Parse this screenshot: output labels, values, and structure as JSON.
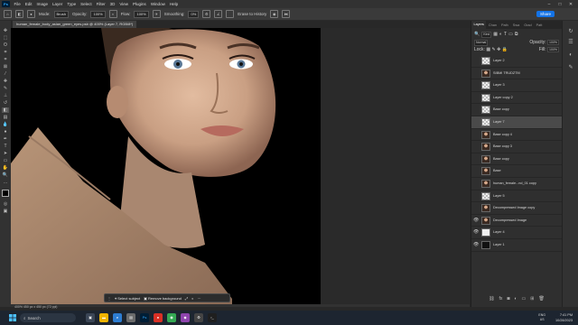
{
  "menu": {
    "items": [
      "File",
      "Edit",
      "Image",
      "Layer",
      "Type",
      "Select",
      "Filter",
      "3D",
      "View",
      "Plugins",
      "Window",
      "Help"
    ]
  },
  "options": {
    "mode_label": "Mode:",
    "mode_value": "Brush",
    "opacity_label": "Opacity:",
    "opacity_value": "100%",
    "flow_label": "Flow:",
    "flow_value": "100%",
    "smoothing_label": "Smoothing:",
    "smoothing_value": "0%",
    "erase_history_label": "Erase to History",
    "share_label": "Share"
  },
  "document": {
    "tab_title": "human_female_body_asian_green_eyes.psb @ 400% (Layer 7, RGB/8*)",
    "status": "400%    450 px x 450 px (72 ppi)"
  },
  "context_bar": {
    "select_subject": "Select subject",
    "remove_background": "Remove background"
  },
  "layers_panel": {
    "tabs": [
      "Layers",
      "Chan",
      "Path",
      "Swa",
      "Grad",
      "Patt"
    ],
    "filter_label": "Kind",
    "blend_mode": "Normal",
    "opacity_label": "Opacity:",
    "opacity_value": "100%",
    "lock_label": "Lock:",
    "fill_label": "Fill:",
    "fill_value": "100%",
    "layers": [
      {
        "name": "Layer 2",
        "thumb": "check",
        "visible": false,
        "selected": false
      },
      {
        "name": "SIBMI TRUDZTM",
        "thumb": "photo",
        "visible": false,
        "selected": false
      },
      {
        "name": "Layer 3",
        "thumb": "check",
        "visible": false,
        "selected": false
      },
      {
        "name": "Layer copy 2",
        "thumb": "check",
        "visible": false,
        "selected": false
      },
      {
        "name": "Base copy",
        "thumb": "check",
        "visible": false,
        "selected": false
      },
      {
        "name": "Layer 7",
        "thumb": "check",
        "visible": false,
        "selected": true
      },
      {
        "name": "Base copy 4",
        "thumb": "photo",
        "visible": false,
        "selected": false
      },
      {
        "name": "Base copy 3",
        "thumb": "photo",
        "visible": false,
        "selected": false
      },
      {
        "name": "Base copy",
        "thumb": "photo",
        "visible": false,
        "selected": false
      },
      {
        "name": "Base",
        "thumb": "photo",
        "visible": false,
        "selected": false
      },
      {
        "name": "human_female...nd_01 copy",
        "thumb": "photo",
        "visible": false,
        "selected": false
      },
      {
        "name": "Layer 5",
        "thumb": "check",
        "visible": false,
        "selected": false
      },
      {
        "name": "Decompressed Image copy",
        "thumb": "photo",
        "visible": false,
        "selected": false
      },
      {
        "name": "Decompressed Image",
        "thumb": "photo",
        "visible": true,
        "selected": false
      },
      {
        "name": "Layer 4",
        "thumb": "white",
        "visible": true,
        "selected": false
      },
      {
        "name": "Layer 1",
        "thumb": "dark",
        "visible": true,
        "selected": false
      }
    ]
  },
  "taskbar": {
    "search_placeholder": "Search",
    "time": "7:41 PM",
    "date": "10/28/2023",
    "lang": "ENG",
    "region": "US"
  },
  "colors": {
    "accent": "#1473e6",
    "canvas_bg": "#000000",
    "skin": "#c9a58a"
  }
}
